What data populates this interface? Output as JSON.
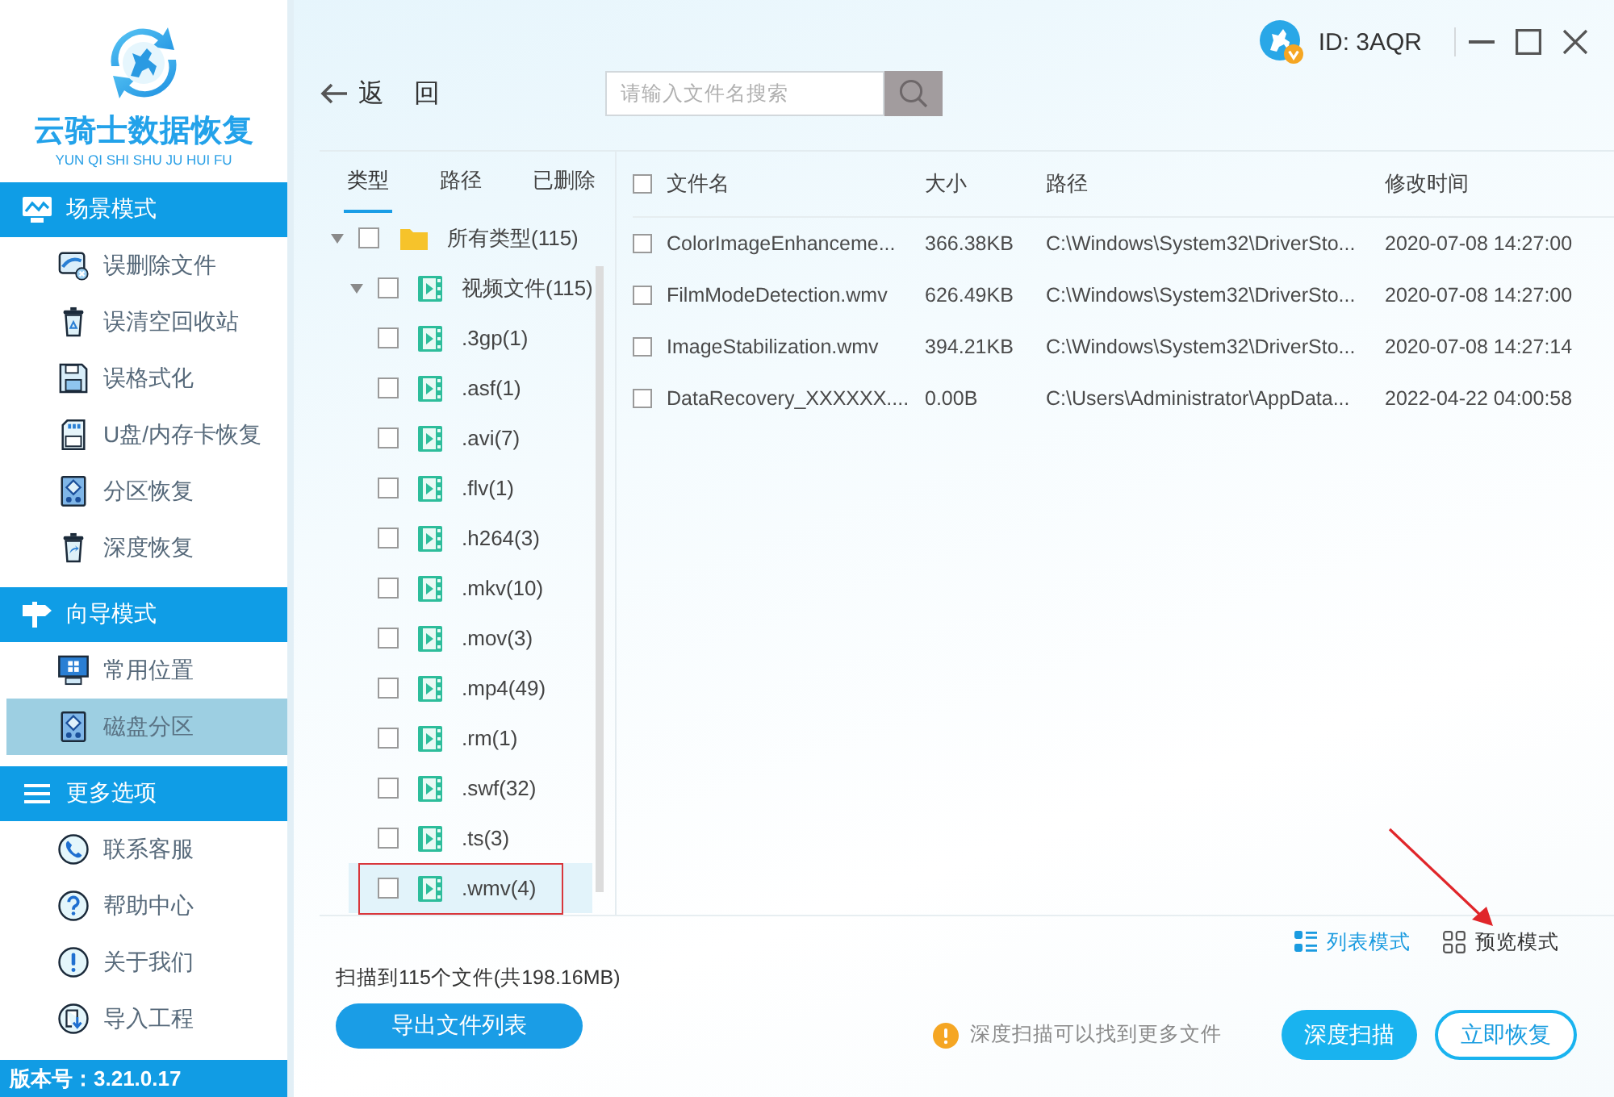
{
  "sidebar": {
    "logo_title": "云骑士数据恢复",
    "logo_subtitle": "YUN QI SHI SHU JU HUI FU",
    "sections": [
      {
        "title": "场景模式",
        "items": [
          {
            "label": "误删除文件",
            "selected": false
          },
          {
            "label": "误清空回收站",
            "selected": false
          },
          {
            "label": "误格式化",
            "selected": false
          },
          {
            "label": "U盘/内存卡恢复",
            "selected": false
          },
          {
            "label": "分区恢复",
            "selected": false
          },
          {
            "label": "深度恢复",
            "selected": false
          }
        ]
      },
      {
        "title": "向导模式",
        "items": [
          {
            "label": "常用位置",
            "selected": false
          },
          {
            "label": "磁盘分区",
            "selected": true
          }
        ]
      },
      {
        "title": "更多选项",
        "items": [
          {
            "label": "联系客服",
            "selected": false
          },
          {
            "label": "帮助中心",
            "selected": false
          },
          {
            "label": "关于我们",
            "selected": false
          },
          {
            "label": "导入工程",
            "selected": false
          }
        ]
      }
    ],
    "version": "版本号：3.21.0.17"
  },
  "account": {
    "id": "ID: 3AQR"
  },
  "toolbar": {
    "back": "返 回",
    "search": {
      "placeholder": "请输入文件名搜索"
    }
  },
  "tree_panel": {
    "tabs": [
      {
        "label": "类型",
        "selected": true
      },
      {
        "label": "路径",
        "selected": false
      },
      {
        "label": "已删除",
        "selected": false
      }
    ],
    "tree": [
      {
        "label": "所有类型(115)",
        "checked": false,
        "expanded": true,
        "selected": false,
        "annotated": false,
        "children": [
          {
            "label": "视频文件(115)",
            "checked": false,
            "expanded": true,
            "selected": false,
            "annotated": false,
            "children": [
              {
                "label": ".3gp(1)",
                "checked": false,
                "selected": false,
                "annotated": false
              },
              {
                "label": ".asf(1)",
                "checked": false,
                "selected": false,
                "annotated": false
              },
              {
                "label": ".avi(7)",
                "checked": false,
                "selected": false,
                "annotated": false
              },
              {
                "label": ".flv(1)",
                "checked": false,
                "selected": false,
                "annotated": false
              },
              {
                "label": ".h264(3)",
                "checked": false,
                "selected": false,
                "annotated": false
              },
              {
                "label": ".mkv(10)",
                "checked": false,
                "selected": false,
                "annotated": false
              },
              {
                "label": ".mov(3)",
                "checked": false,
                "selected": false,
                "annotated": false
              },
              {
                "label": ".mp4(49)",
                "checked": false,
                "selected": false,
                "annotated": false
              },
              {
                "label": ".rm(1)",
                "checked": false,
                "selected": false,
                "annotated": false
              },
              {
                "label": ".swf(32)",
                "checked": false,
                "selected": false,
                "annotated": false
              },
              {
                "label": ".ts(3)",
                "checked": false,
                "selected": false,
                "annotated": false
              },
              {
                "label": ".wmv(4)",
                "checked": false,
                "selected": true,
                "annotated": true
              }
            ]
          }
        ]
      }
    ]
  },
  "table": {
    "header_checked": false,
    "columns": [
      "文件名",
      "大小",
      "路径",
      "修改时间"
    ],
    "rows": [
      {
        "name": "ColorImageEnhanceme...",
        "size": "366.38KB",
        "path": "C:\\Windows\\System32\\DriverSto...",
        "modified": "2020-07-08 14:27:00",
        "checked": false
      },
      {
        "name": "FilmModeDetection.wmv",
        "size": "626.49KB",
        "path": "C:\\Windows\\System32\\DriverSto...",
        "modified": "2020-07-08 14:27:00",
        "checked": false
      },
      {
        "name": "ImageStabilization.wmv",
        "size": "394.21KB",
        "path": "C:\\Windows\\System32\\DriverSto...",
        "modified": "2020-07-08 14:27:14",
        "checked": false
      },
      {
        "name": "DataRecovery_XXXXXX....",
        "size": "0.00B",
        "path": "C:\\Users\\Administrator\\AppData...",
        "modified": "2022-04-22 04:00:58",
        "checked": false
      }
    ]
  },
  "view_modes": [
    {
      "label": "列表模式",
      "selected": true,
      "annotated": false
    },
    {
      "label": "预览模式",
      "selected": false,
      "annotated": true
    }
  ],
  "status": {
    "summary": "扫描到115个文件(共198.16MB)",
    "export_button": "导出文件列表",
    "tip": "深度扫描可以找到更多文件"
  },
  "actions": [
    {
      "label": "深度扫描",
      "kind": "filled"
    },
    {
      "label": "立即恢复",
      "kind": "outline"
    }
  ]
}
